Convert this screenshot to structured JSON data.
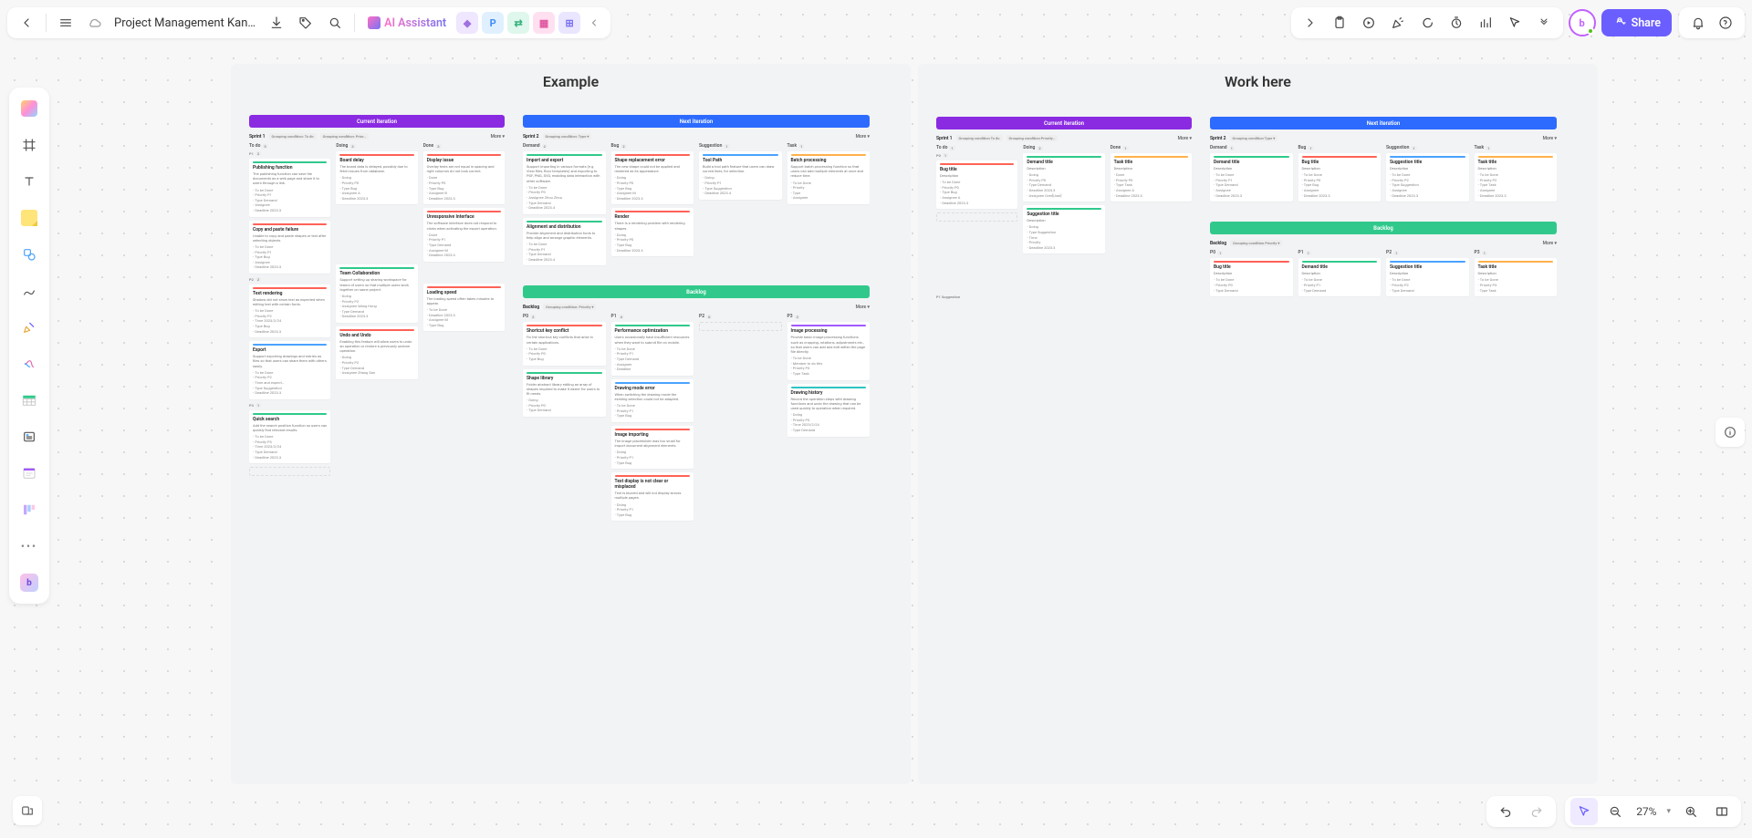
{
  "header": {
    "doc_title": "Project Management Kan…",
    "ai_label": "AI Assistant",
    "share_label": "Share"
  },
  "zoom": {
    "percent": "27%"
  },
  "frames": {
    "example": {
      "title": "Example"
    },
    "work": {
      "title": "Work here"
    }
  },
  "iter_labels": {
    "current": "Current iteration",
    "next": "Next iteration",
    "backlog": "Backlog"
  },
  "example": {
    "sprint1": {
      "name": "Sprint 1",
      "tag1": "Grouping condition: To do",
      "tag2": "Grouping condition: Prior…",
      "more": "More ▾",
      "columns": {
        "todo": {
          "label": "To do",
          "count": "5",
          "sub1": {
            "label": "P1",
            "count": "2"
          },
          "sub2": {
            "label": "P2",
            "count": "2"
          },
          "sub3": {
            "label": "P3",
            "count": "1"
          }
        },
        "doing": {
          "label": "Doing",
          "count": "3"
        },
        "done": {
          "label": "Done",
          "count": "3"
        }
      },
      "cards": {
        "todo_p1_a": {
          "title": "Publishing function",
          "desc": "The publishing function can save the documents as a web page and share it to users through a link.",
          "meta": [
            "To be Done",
            "Priority P1",
            "Type Demand",
            "Assignee",
            "Deadline 2023.3"
          ]
        },
        "todo_p1_b": {
          "title": "Copy and paste failure",
          "desc": "Unable to copy and paste shapes or text after selecting objects.",
          "meta": [
            "To be Done",
            "Priority P1",
            "Type Bug",
            "Assignee",
            "Deadline 2023.3"
          ]
        },
        "todo_p2_a": {
          "title": "Text rendering",
          "desc": "Shadow did not show text as expected when editing text with certain fonts.",
          "meta": [
            "To be Done",
            "Priority P2",
            "Time 2023/2/24",
            "Type Bug",
            "Deadline 2023.3"
          ]
        },
        "todo_p2_b": {
          "title": "Export",
          "desc": "Support exporting drawings and entries as files so that users can share them with others easily.",
          "meta": [
            "To be Done",
            "Priority P2",
            "Time and expect…",
            "Type Suggestion",
            "Deadline 2023.3"
          ]
        },
        "todo_p3_a": {
          "title": "Quick search",
          "desc": "Add the search position function so users can quickly find relevant results.",
          "meta": [
            "To be Done",
            "Priority P3",
            "Time 2023/2/24",
            "Type Demand",
            "Deadline 2023.3"
          ]
        },
        "doing_a": {
          "title": "Board delay",
          "desc": "The board data is delayed, possibly due to fetch issues from database.",
          "meta": [
            "Doing",
            "Priority P0",
            "Type Bug",
            "Assignee A",
            "Deadline 2023.3"
          ]
        },
        "doing_b": {
          "title": "Team Collaboration",
          "desc": "Support setting up sharing workspace for teams of users so that multiple users work together on same project.",
          "meta": [
            "Doing",
            "Priority P2",
            "Assignee Wang Hong",
            "Type Demand",
            "Deadline 2023.3"
          ]
        },
        "doing_c": {
          "title": "Undo and Undo",
          "desc": "Enabling this feature will allow users to undo an operation or restore a previously undone operation.",
          "meta": [
            "Doing",
            "Priority P2",
            "Type Demand",
            "Assignee Zhang San"
          ]
        },
        "done_a": {
          "title": "Display issue",
          "desc": "Overlay texts are not equal in spacing and right columns do not look correct.",
          "meta": [
            "Done",
            "Priority P0",
            "Type Bug",
            "Assignee B",
            "Deadline 2023.3"
          ]
        },
        "done_b": {
          "title": "Unresponsive Interface",
          "desc": "The software interface does not respond to clicks when activating the export operation.",
          "meta": [
            "Done",
            "Priority P1",
            "Type Demand",
            "Assignee M",
            "Deadline 2023.3"
          ]
        },
        "done_c": {
          "title": "Loading speed",
          "desc": "The loading speed often takes minutes to appear.",
          "meta": [
            "To be Done",
            "Deadline 2023.3",
            "Assignee M",
            "Type Bug"
          ]
        }
      }
    },
    "sprint2": {
      "name": "Sprint 2",
      "tag1": "Grouping condition: Type ▾",
      "more": "More ▾",
      "columns": {
        "demand": {
          "label": "Demand",
          "count": "2"
        },
        "bug": {
          "label": "Bug",
          "count": "2"
        },
        "suggestion": {
          "label": "Suggestion",
          "count": "1"
        },
        "task": {
          "label": "Task",
          "count": "1"
        }
      },
      "cards": {
        "demand_a": {
          "title": "Import and export",
          "desc": "Support importing in various formats (e.g. Visio files, floor templates) and exporting to PDF, PNG, SVG, enabling data interaction with other software.",
          "meta": [
            "To be Done",
            "Priority P0",
            "Assignee Zhou Zhou",
            "Type Demand",
            "Deadline 2023.4"
          ]
        },
        "demand_b": {
          "title": "Alignment and distribution",
          "desc": "Provide alignment and distribution tools to help align and arrange graphic elements.",
          "meta": [
            "To be Done",
            "Priority P1",
            "Type Demand",
            "Deadline 2023.4"
          ]
        },
        "bug_a": {
          "title": "Shape replacement error",
          "desc": "The new shape could not be applied and rendered as its appearance.",
          "meta": [
            "Doing",
            "Priority P0",
            "Type Bug",
            "Assignee M",
            "Deadline 2023.3"
          ]
        },
        "bug_b": {
          "title": "Render",
          "desc": "There is a rendering problem with rendering shapes.",
          "meta": [
            "Doing",
            "Priority P0",
            "Type Bug",
            "Deadline 2023.4"
          ]
        },
        "sugg_a": {
          "title": "Tool Path",
          "desc": "Build a tool path feature that users can draw curved lines, for selection.",
          "meta": [
            "Doing",
            "Priority P1",
            "Type Suggestion",
            "Deadline 2023.4"
          ]
        },
        "task_a": {
          "title": "Batch processing",
          "desc": "Support batch processing function so that users can add multiple elements at once and reduce time.",
          "meta": [
            "To be Done",
            "Priority",
            "Type",
            "Assignee"
          ]
        }
      }
    },
    "backlog": {
      "name": "Backlog",
      "tag1": "Grouping condition: Priority ▾",
      "more": "More ▾",
      "columns": {
        "p0": {
          "label": "P0",
          "count": "2"
        },
        "p1": {
          "label": "P1",
          "count": "4"
        },
        "p2": {
          "label": "P2",
          "count": "0"
        },
        "p3": {
          "label": "P3",
          "count": "2"
        }
      },
      "cards": {
        "p0_a": {
          "title": "Shortcut key conflict",
          "desc": "Fix the shortcut key conflicts that arise in certain applications.",
          "meta": [
            "To be Done",
            "Priority P0",
            "Type Bug"
          ]
        },
        "p0_b": {
          "title": "Shape library",
          "desc": "Folder abstract library editing an array of shapes required to make it easier for users to fit needs.",
          "meta": [
            "Doing",
            "Priority P0",
            "Type Demand"
          ]
        },
        "p1_a": {
          "title": "Performance optimization",
          "desc": "Users occasionally have insufficient resources when they want to submit file on mobile.",
          "meta": [
            "To be Done",
            "Priority P1",
            "Type Demand",
            "Assignee",
            "Deadline"
          ]
        },
        "p1_b": {
          "title": "Drawing mode error",
          "desc": "When switching the drawing mode the existing selection could not be adapted.",
          "meta": [
            "To be Done",
            "Priority P1",
            "Type Bug"
          ]
        },
        "p1_c": {
          "title": "Image importing",
          "desc": "The image placeholder was too small for import document alignment elements.",
          "meta": [
            "Doing",
            "Priority P1",
            "Type Bug"
          ]
        },
        "p1_d": {
          "title": "Text display is not clear or misplaced",
          "desc": "Text is blurred and will not display across multiple pages.",
          "meta": [
            "Doing",
            "Priority P1",
            "Type Bug"
          ]
        },
        "p3_a": {
          "title": "Image processing",
          "desc": "Provide basic image processing functions such as cropping, rotations, adjustments etc., so that users can add and edit within the page file directly.",
          "meta": [
            "To be Done",
            "Member to do this",
            "Priority P3",
            "Type Task"
          ]
        },
        "p3_b": {
          "title": "Drawing history",
          "desc": "Record the operation steps with drawing functions and undo the drawing that can be used quickly to operation when required.",
          "meta": [
            "Doing",
            "Priority P3",
            "Time 2023/2/24",
            "Type Demand"
          ]
        }
      }
    }
  },
  "work": {
    "sprint1": {
      "name": "Sprint 1",
      "tag1": "Grouping condition To do",
      "tag2": "Grouping condition Priority…",
      "more": "More ▾",
      "columns": {
        "todo": {
          "label": "To do",
          "count": "1"
        },
        "doing": {
          "label": "Doing",
          "count": "2"
        },
        "done": {
          "label": "Done",
          "count": "1"
        }
      },
      "sub": {
        "p0": {
          "label": "P0",
          "count": "1"
        },
        "p1": {
          "label": "P1 Suggestion",
          "count": ""
        }
      },
      "cards": {
        "todo_a": {
          "title": "Bug title",
          "desc": "Description",
          "meta": [
            "To be Done",
            "Priority P0",
            "Type Bug",
            "Assignee A",
            "Deadline 2023.3"
          ]
        },
        "doing_a": {
          "title": "Demand title",
          "desc": "Description",
          "meta": [
            "Doing",
            "Priority P0",
            "Type Demand",
            "Deadline 2023.3",
            "Assignee Over[User]"
          ]
        },
        "doing_b": {
          "title": "Suggestion title",
          "desc": "Description",
          "meta": [
            "Doing",
            "Type Suggestion",
            "Time",
            "Priority",
            "Deadline 2023.3"
          ]
        },
        "done_a": {
          "title": "Task title",
          "desc": "Description",
          "meta": [
            "Done",
            "Priority P0",
            "Type Task",
            "Assignee A",
            "Deadline 2023.3"
          ]
        }
      }
    },
    "sprint2": {
      "name": "Sprint 2",
      "tag1": "Grouping condition Type ▾",
      "more": "More ▾",
      "columns": {
        "demand": {
          "label": "Demand",
          "count": "1"
        },
        "bug": {
          "label": "Bug",
          "count": "1"
        },
        "suggestion": {
          "label": "Suggestion",
          "count": "1"
        },
        "task": {
          "label": "Task",
          "count": "1"
        }
      },
      "cards": {
        "demand_a": {
          "title": "Demand title",
          "desc": "Description",
          "meta": [
            "To be Done",
            "Priority P1",
            "Type Demand",
            "Assignee",
            "Deadline 2023.3"
          ]
        },
        "bug_a": {
          "title": "Bug title",
          "desc": "Description",
          "meta": [
            "To be Done",
            "Priority P0",
            "Type Bug",
            "Assignee",
            "Deadline 2023.3"
          ]
        },
        "sugg_a": {
          "title": "Suggestion title",
          "desc": "Description",
          "meta": [
            "To be Done",
            "Priority P2",
            "Type Suggestion",
            "Assignee",
            "Deadline 2023.3"
          ]
        },
        "task_a": {
          "title": "Task title",
          "desc": "Description",
          "meta": [
            "To be Done",
            "Priority P2",
            "Type Task",
            "Assignee",
            "Deadline 2023.3"
          ]
        }
      }
    },
    "backlog": {
      "name": "Backlog",
      "tag1": "Grouping condition Priority ▾",
      "more": "More ▾",
      "columns": {
        "p0": {
          "label": "P0",
          "count": "1"
        },
        "p1": {
          "label": "P1",
          "count": "1"
        },
        "p2": {
          "label": "P2",
          "count": "1"
        },
        "p3": {
          "label": "P3",
          "count": "1"
        }
      },
      "cards": {
        "p0_a": {
          "title": "Bug title",
          "desc": "Description",
          "meta": [
            "To be Done",
            "Priority P0",
            "Type Demand"
          ]
        },
        "p1_a": {
          "title": "Demand title",
          "desc": "Description",
          "meta": [
            "To be Done",
            "Priority P1",
            "Type Demand"
          ]
        },
        "p2_a": {
          "title": "Suggestion title",
          "desc": "Description",
          "meta": [
            "To be Done",
            "Priority P2",
            "Type Demand"
          ]
        },
        "p3_a": {
          "title": "Task title",
          "desc": "Description",
          "meta": [
            "To be Done",
            "Priority P3",
            "Type Task"
          ]
        }
      }
    }
  }
}
